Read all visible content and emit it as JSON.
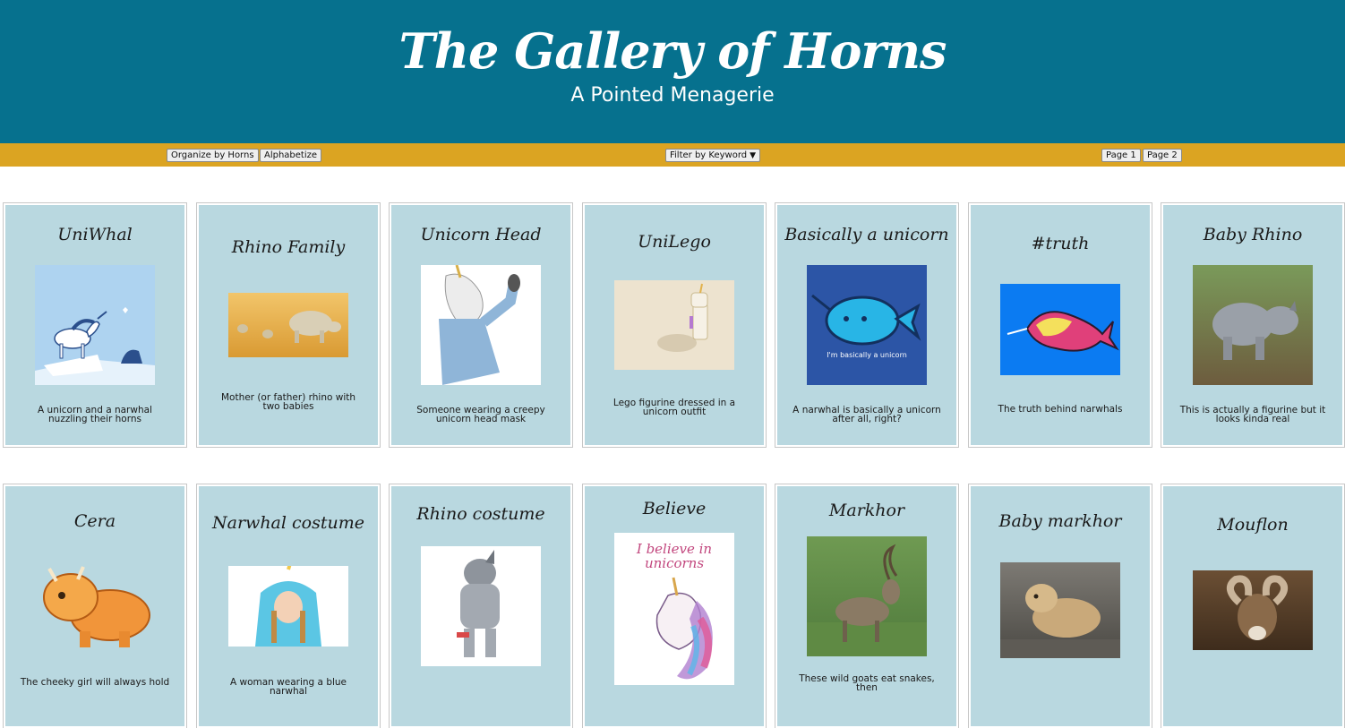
{
  "header": {
    "title": "The Gallery of Horns",
    "subtitle": "A Pointed Menagerie",
    "background": "#06718e"
  },
  "toolbar": {
    "background": "#dba422",
    "sort_horns_label": "Organize by Horns",
    "sort_alpha_label": "Alphabetize",
    "filter_label": "Filter by Keyword",
    "page1_label": "Page 1",
    "page2_label": "Page 2"
  },
  "gallery": {
    "card_background": "#b9d8e0",
    "cards": [
      {
        "title": "UniWhal",
        "description": "A unicorn and a narwhal nuzzling their horns",
        "image": "unicorn-narwhal-illustration"
      },
      {
        "title": "Rhino Family",
        "description": "Mother (or father) rhino with two babies",
        "image": "rhino-family-photo"
      },
      {
        "title": "Unicorn Head",
        "description": "Someone wearing a creepy unicorn head mask",
        "image": "unicorn-mask-photo"
      },
      {
        "title": "UniLego",
        "description": "Lego figurine dressed in a unicorn outfit",
        "image": "lego-unicorn-photo"
      },
      {
        "title": "Basically a unicorn",
        "description": "A narwhal is basically a unicorn after all, right?",
        "image": "narwhal-cartoon",
        "image_caption": "I'm basically a unicorn"
      },
      {
        "title": "#truth",
        "description": "The truth behind narwhals",
        "image": "narwhal-truth-illustration"
      },
      {
        "title": "Baby Rhino",
        "description": "This is actually a figurine but it looks kinda real",
        "image": "baby-rhino-figurine-photo"
      },
      {
        "title": "Cera",
        "description": "The cheeky girl will always hold",
        "image": "triceratops-cartoon"
      },
      {
        "title": "Narwhal costume",
        "description": "A woman wearing a blue narwhal",
        "image": "narwhal-costume-photo"
      },
      {
        "title": "Rhino costume",
        "description": "",
        "image": "rhino-mascot-photo"
      },
      {
        "title": "Believe",
        "description": "",
        "image": "believe-unicorn-watercolor",
        "image_caption": "I believe in unicorns"
      },
      {
        "title": "Markhor",
        "description": "These wild goats eat snakes, then",
        "image": "markhor-photo"
      },
      {
        "title": "Baby markhor",
        "description": "",
        "image": "baby-markhor-photo"
      },
      {
        "title": "Mouflon",
        "description": "",
        "image": "mouflon-photo"
      }
    ]
  }
}
